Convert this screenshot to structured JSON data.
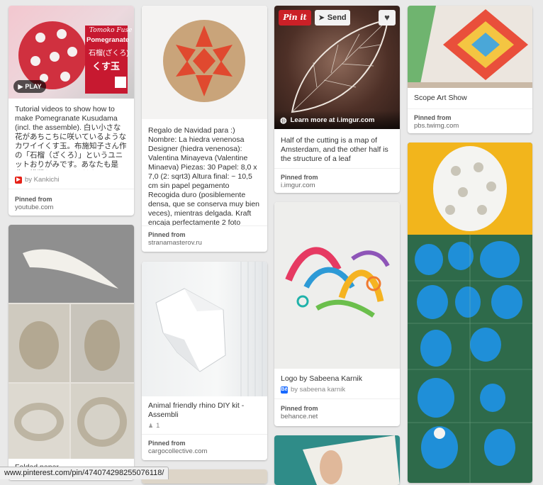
{
  "pins": [
    {
      "desc": "Tutorial videos to show how to make Pomegranate Kusudama (incl. the assemble). 白い小さな花があちこちに咲いているようなカワイイくす玉。布施知子さん作の「石榴（ざくろ）」というユニットおりがみです。あなたも是非、挑戦してみてください。I...",
      "by": "by Kankichi",
      "pinned_from": "Pinned from",
      "domain": "youtube.com",
      "overlay": {
        "author": "Tomoko Fuse",
        "title": "Pomegranate",
        "jp1": "石榴(ざくろ)",
        "jp2": "くす玉"
      },
      "play": "PLAY"
    },
    {
      "caption": "Folded paper"
    },
    {
      "desc": "Regalo de Navidad para :) Nombre: La hiedra venenosa Designer (hiedra venenosa): Valentina Minayeva (Valentine Minaeva) Piezas: 30 Papel: 8,0 x 7,0 (2: sqrt3) Altura final: ~ 10,5 cm sin papel pegamento Recogida duro (posiblemente densa, que se conserva muy bien veces), mientras delgada. Kraft encaja perfectamente 2 foto",
      "pinned_from": "Pinned from",
      "domain": "stranamasterov.ru"
    },
    {
      "desc": "Animal friendly rhino DIY kit - Assembli",
      "likes": "1",
      "pinned_from": "Pinned from",
      "domain": "cargocollective.com"
    },
    {
      "desc": "Half of the cutting is a map of Amsterdam, and the other half is the structure of a leaf",
      "pinned_from": "Pinned from",
      "domain": "i.imgur.com",
      "pin_it": "Pin it",
      "send": "Send",
      "learn_more": "Learn more at i.imgur.com"
    },
    {
      "desc": "Logo by Sabeena Karnik",
      "by": "by sabeena karnik",
      "pinned_from": "Pinned from",
      "domain": "behance.net"
    },
    {
      "desc": "Scope Art Show",
      "pinned_from": "Pinned from",
      "domain": "pbs.twimg.com"
    }
  ],
  "status_url": "www.pinterest.com/pin/474074298255076118/",
  "icons": [
    "play-icon",
    "send-icon",
    "heart-icon",
    "globe-icon",
    "youtube-icon",
    "behance-icon",
    "like-count-icon"
  ],
  "colors": {
    "background": "#e9e9e9",
    "pin_it_red": "#cb2027",
    "youtube_red": "#e62117",
    "behance_blue": "#1769ff"
  }
}
